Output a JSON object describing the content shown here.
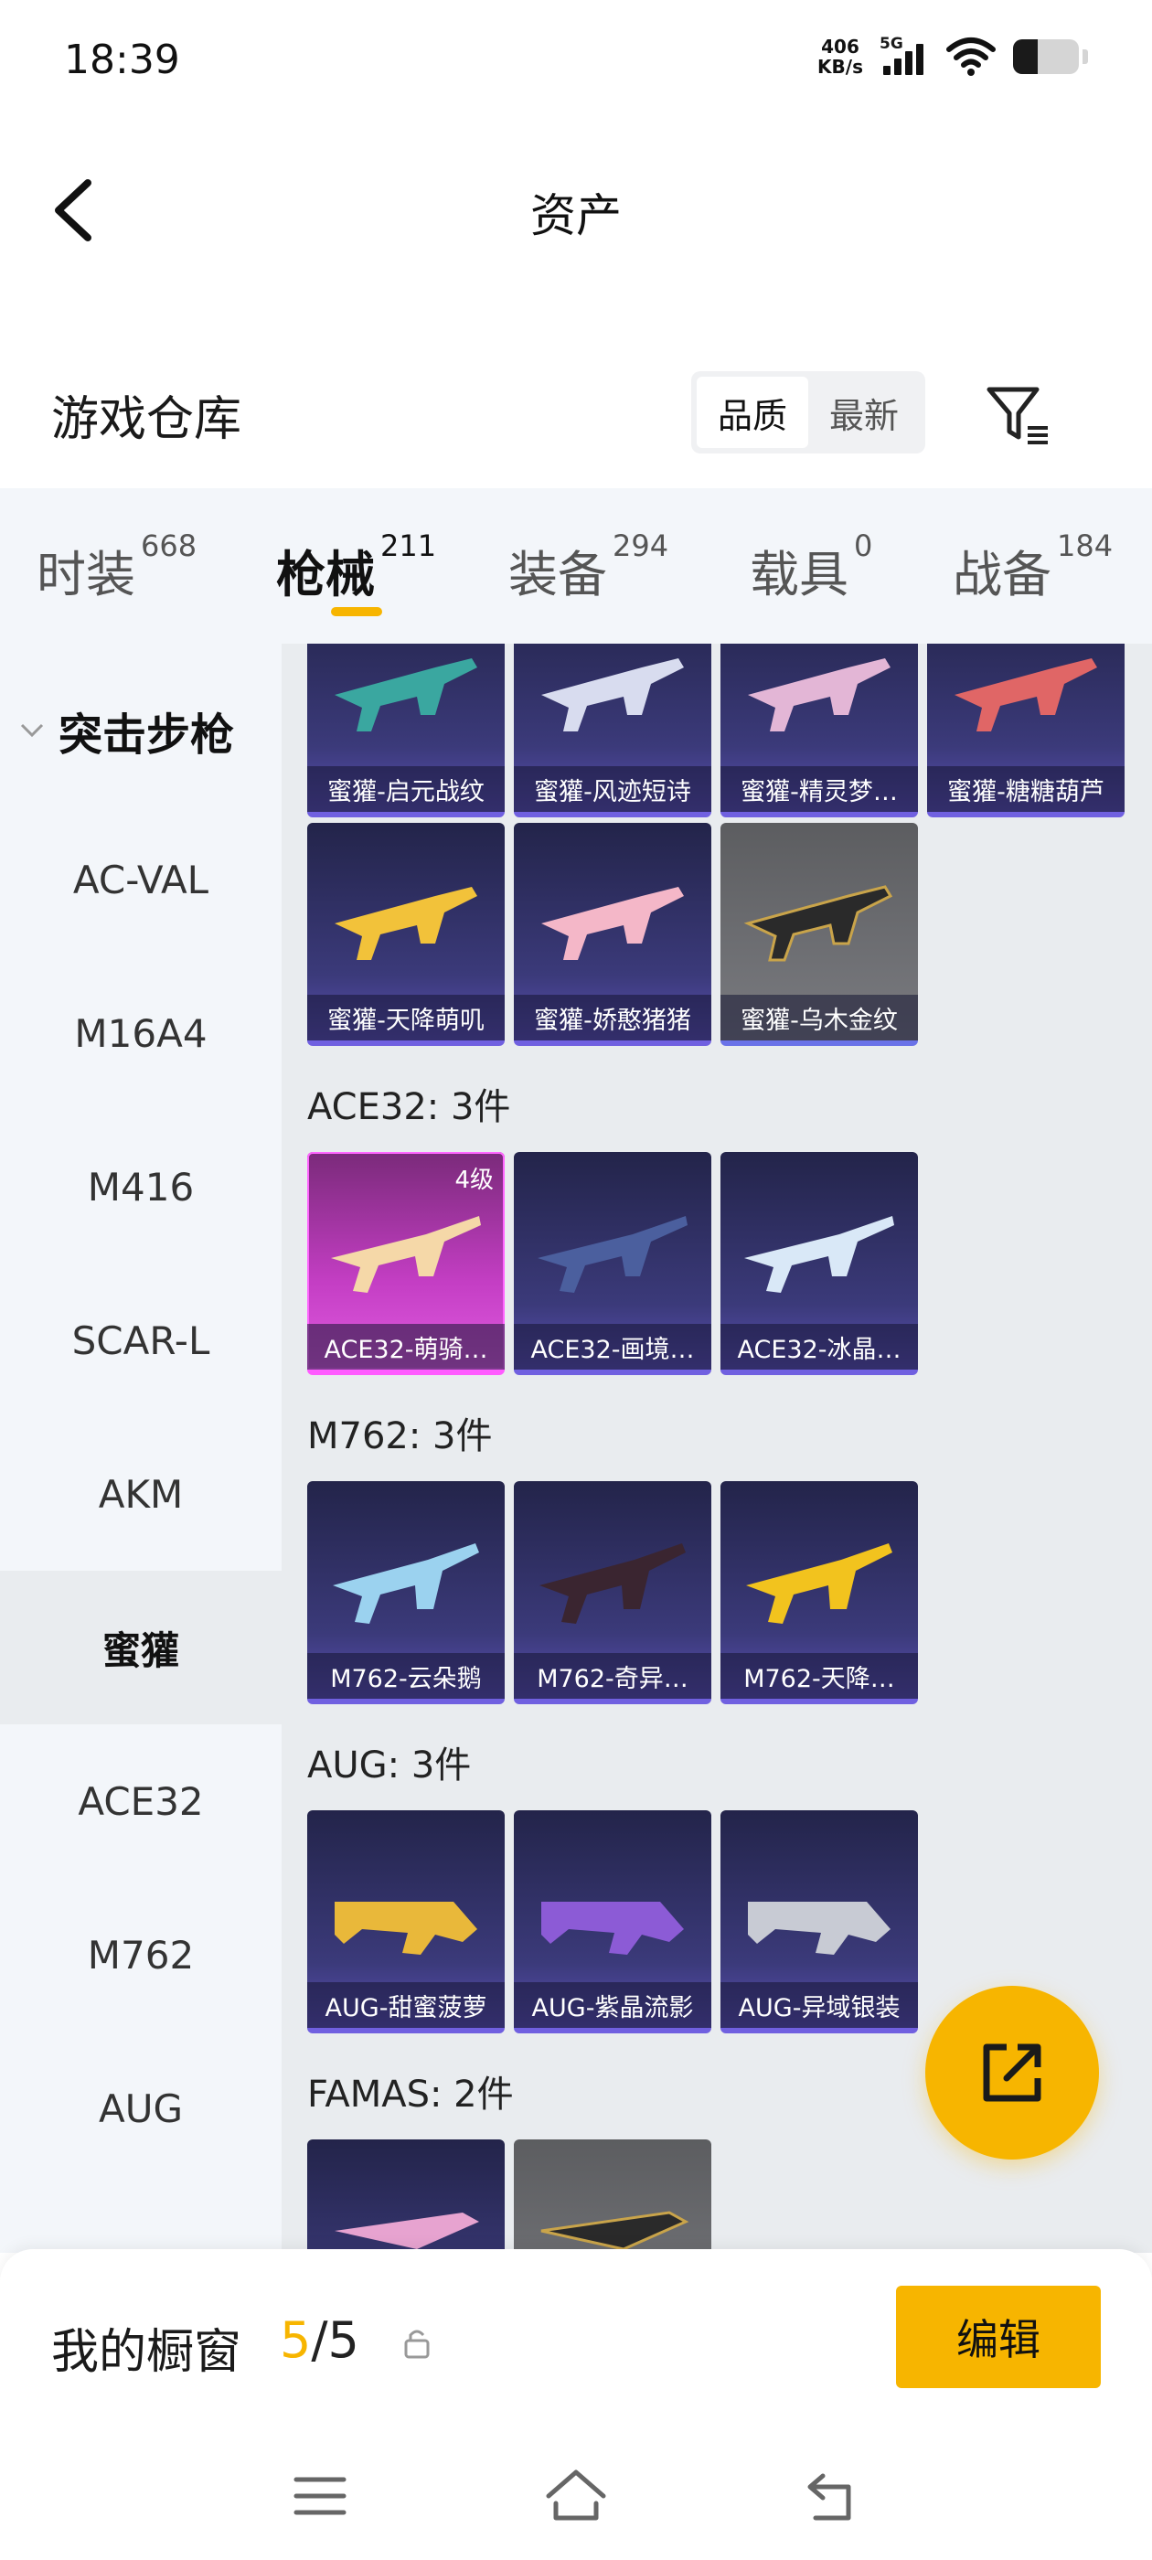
{
  "status": {
    "time": "18:39",
    "netspeed_value": "406",
    "netspeed_unit": "KB/s",
    "network": "5G",
    "battery_level": 0.38
  },
  "header": {
    "title": "资产"
  },
  "warehouse": {
    "title": "游戏仓库",
    "sort_options": [
      "品质",
      "最新"
    ],
    "active_sort": "品质"
  },
  "tabs": [
    {
      "label": "时装",
      "count": "668"
    },
    {
      "label": "枪械",
      "count": "211",
      "active": true
    },
    {
      "label": "装备",
      "count": "294"
    },
    {
      "label": "载具",
      "count": "0"
    },
    {
      "label": "战备",
      "count": "184"
    }
  ],
  "sidebar": {
    "category": "突击步枪",
    "items": [
      "AC-VAL",
      "M16A4",
      "M416",
      "SCAR-L",
      "AKM",
      "蜜獾",
      "ACE32",
      "M762",
      "AUG"
    ],
    "active": "蜜獾"
  },
  "sections": [
    {
      "title": "",
      "items": [
        {
          "name": "蜜獾-启元战纹"
        },
        {
          "name": "蜜獾-风迹短诗"
        },
        {
          "name": "蜜獾-精灵梦…"
        },
        {
          "name": "蜜獾-糖糖葫芦"
        },
        {
          "name": "蜜獾-天降萌叽"
        },
        {
          "name": "蜜獾-娇憨猪猪"
        },
        {
          "name": "蜜獾-乌木金纹"
        }
      ]
    },
    {
      "title": "ACE32: 3件",
      "items": [
        {
          "name": "ACE32-萌骑…",
          "level": "4级"
        },
        {
          "name": "ACE32-画境…"
        },
        {
          "name": "ACE32-冰晶…"
        }
      ]
    },
    {
      "title": "M762: 3件",
      "items": [
        {
          "name": "M762-云朵鹅"
        },
        {
          "name": "M762-奇异…"
        },
        {
          "name": "M762-天降…"
        }
      ]
    },
    {
      "title": "AUG: 3件",
      "items": [
        {
          "name": "AUG-甜蜜菠萝"
        },
        {
          "name": "AUG-紫晶流影"
        },
        {
          "name": "AUG-异域银装"
        }
      ]
    },
    {
      "title": "FAMAS: 2件",
      "items": []
    }
  ],
  "showcase": {
    "label": "我的橱窗",
    "current": "5",
    "total": "/5",
    "edit_label": "编辑"
  },
  "icons": {
    "back": "back-arrow-icon",
    "filter": "filter-icon",
    "share": "share-export-icon",
    "lock": "lock-icon"
  },
  "colors": {
    "accent": "#f7b500",
    "card_bg": "#3b3a7a"
  }
}
